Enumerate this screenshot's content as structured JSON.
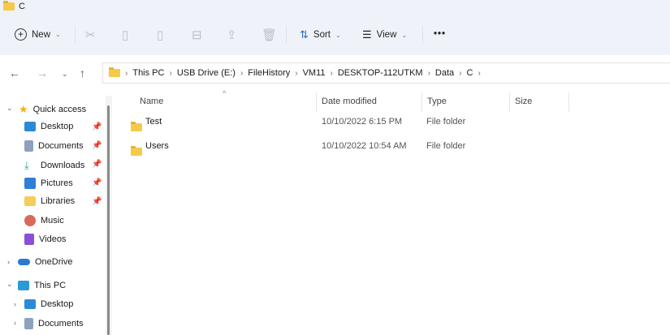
{
  "window": {
    "title": "C"
  },
  "toolbar": {
    "new": "New",
    "sort": "Sort",
    "view": "View",
    "more": "•••"
  },
  "address": {
    "crumbs": [
      "This PC",
      "USB Drive (E:)",
      "FileHistory",
      "VM11",
      "DESKTOP-112UTKM",
      "Data",
      "C"
    ]
  },
  "sidebar": {
    "quick_access": "Quick access",
    "quick_items": [
      {
        "label": "Desktop",
        "color": "#2b8ad6"
      },
      {
        "label": "Documents",
        "color": "#8da1bf"
      },
      {
        "label": "Downloads",
        "color": "#2aa37a"
      },
      {
        "label": "Pictures",
        "color": "#2f7fd6"
      },
      {
        "label": "Libraries",
        "color": "#f4cd5a"
      },
      {
        "label": "Music",
        "color": "#d9695a"
      },
      {
        "label": "Videos",
        "color": "#8a4fd6"
      }
    ],
    "onedrive": "OneDrive",
    "this_pc": "This PC",
    "pc_items": [
      {
        "label": "Desktop",
        "color": "#2b8ad6"
      },
      {
        "label": "Documents",
        "color": "#8da1bf"
      }
    ]
  },
  "columns": {
    "name": "Name",
    "date": "Date modified",
    "type": "Type",
    "size": "Size"
  },
  "files": [
    {
      "name": "Test",
      "date": "10/10/2022 6:15 PM",
      "type": "File folder",
      "size": ""
    },
    {
      "name": "Users",
      "date": "10/10/2022 10:54 AM",
      "type": "File folder",
      "size": ""
    }
  ]
}
